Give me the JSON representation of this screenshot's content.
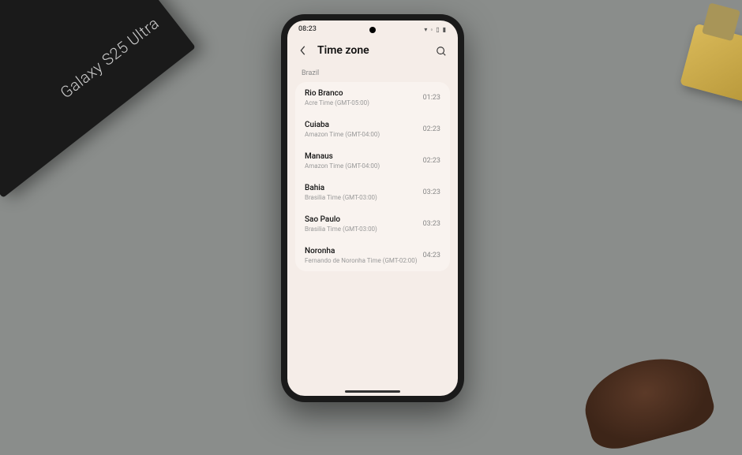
{
  "box_label": "Galaxy S25 Ultra",
  "status": {
    "time": "08:23",
    "icons": "▾ ◦ ▯ ▮"
  },
  "header": {
    "title": "Time zone"
  },
  "section_label": "Brazil",
  "timezones": [
    {
      "city": "Rio Branco",
      "desc": "Acre Time (GMT-05:00)",
      "time": "01:23"
    },
    {
      "city": "Cuiaba",
      "desc": "Amazon Time (GMT-04:00)",
      "time": "02:23"
    },
    {
      "city": "Manaus",
      "desc": "Amazon Time (GMT-04:00)",
      "time": "02:23"
    },
    {
      "city": "Bahia",
      "desc": "Brasilia Time (GMT-03:00)",
      "time": "03:23"
    },
    {
      "city": "Sao Paulo",
      "desc": "Brasilia Time (GMT-03:00)",
      "time": "03:23"
    },
    {
      "city": "Noronha",
      "desc": "Fernando de Noronha Time (GMT-02:00)",
      "time": "04:23"
    }
  ]
}
